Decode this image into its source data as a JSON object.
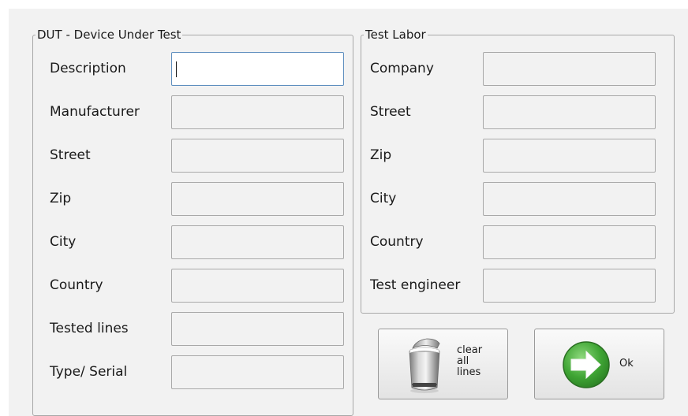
{
  "dut": {
    "title": "DUT - Device Under Test",
    "fields": [
      {
        "label": "Description",
        "value": ""
      },
      {
        "label": "Manufacturer",
        "value": ""
      },
      {
        "label": "Street",
        "value": ""
      },
      {
        "label": "Zip",
        "value": ""
      },
      {
        "label": "City",
        "value": ""
      },
      {
        "label": "Country",
        "value": ""
      },
      {
        "label": "Tested lines",
        "value": ""
      },
      {
        "label": "Type/ Serial",
        "value": ""
      }
    ]
  },
  "lab": {
    "title": "Test Labor",
    "fields": [
      {
        "label": "Company",
        "value": ""
      },
      {
        "label": "Street",
        "value": ""
      },
      {
        "label": "Zip",
        "value": ""
      },
      {
        "label": "City",
        "value": ""
      },
      {
        "label": "Country",
        "value": ""
      },
      {
        "label": "Test engineer",
        "value": ""
      }
    ]
  },
  "buttons": {
    "clear_label": "clear\nall\nlines",
    "clear_icon": "trash-can-icon",
    "ok_label": "Ok",
    "ok_icon": "arrow-right-icon"
  },
  "colors": {
    "dialog_bg": "#f2f2f2",
    "focus_border": "#5f8fbf",
    "ok_green": "#3fa534"
  }
}
